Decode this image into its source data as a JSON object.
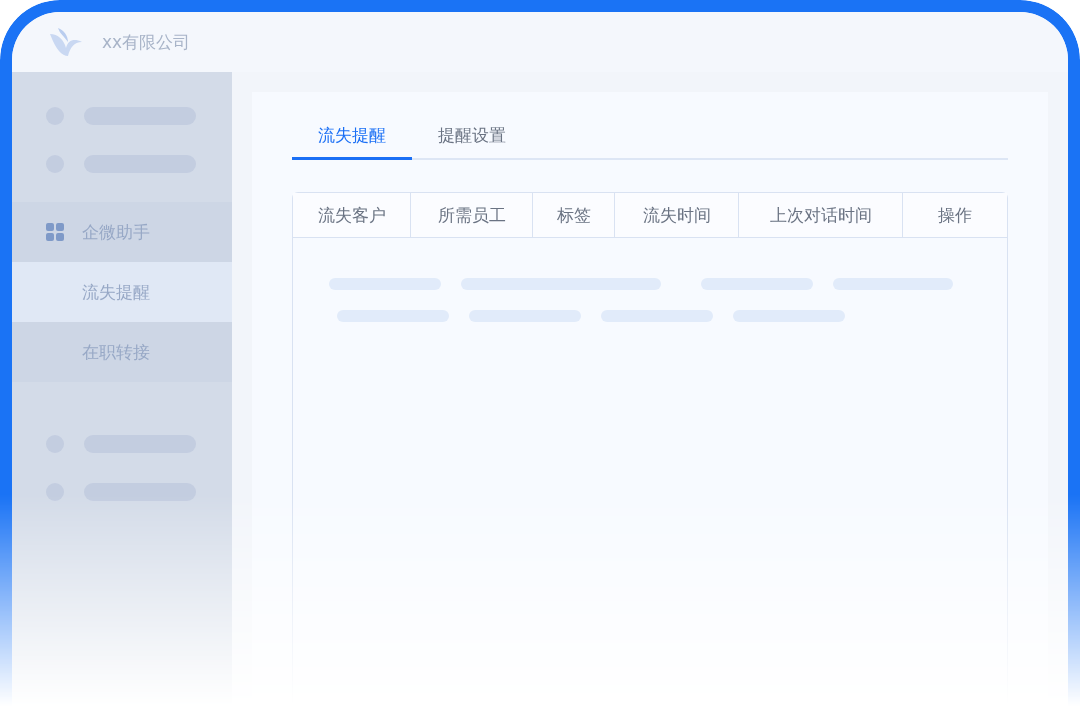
{
  "header": {
    "company": "xx有限公司"
  },
  "sidebar": {
    "items": [
      {
        "kind": "placeholder"
      },
      {
        "kind": "placeholder"
      },
      {
        "kind": "group",
        "label": "企微助手",
        "children": [
          {
            "label": "流失提醒",
            "selected": true
          },
          {
            "label": "在职转接",
            "selected": false
          }
        ]
      },
      {
        "kind": "placeholder"
      },
      {
        "kind": "placeholder"
      }
    ]
  },
  "tabs": [
    {
      "label": "流失提醒",
      "selected": true
    },
    {
      "label": "提醒设置",
      "selected": false
    }
  ],
  "table": {
    "columns": [
      "流失客户",
      "所需员工",
      "标签",
      "流失时间",
      "上次对话时间",
      "操作"
    ]
  }
}
